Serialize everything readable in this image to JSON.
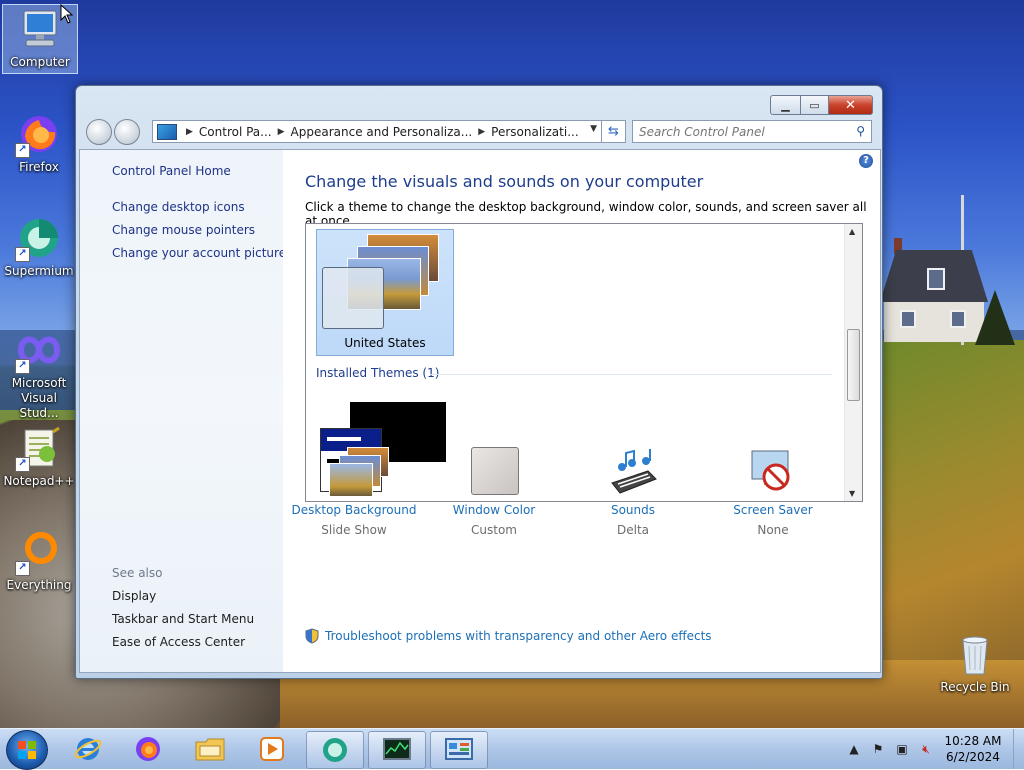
{
  "desktop": {
    "icons": [
      {
        "label": "Computer",
        "selected": true
      },
      {
        "label": "Firefox"
      },
      {
        "label": "Supermium"
      },
      {
        "label": "Microsoft Visual Stud..."
      },
      {
        "label": "Notepad++"
      },
      {
        "label": "Everything"
      },
      {
        "label": "Recycle Bin"
      }
    ]
  },
  "window": {
    "address": {
      "crumbs": [
        "Control Pa...",
        "Appearance and Personaliza...",
        "Personalizati..."
      ]
    },
    "search": {
      "placeholder": "Search Control Panel"
    },
    "left_pane": {
      "home": "Control Panel Home",
      "links": [
        "Change desktop icons",
        "Change mouse pointers",
        "Change your account picture"
      ],
      "see_also_header": "See also",
      "see_also": [
        "Display",
        "Taskbar and Start Menu",
        "Ease of Access Center"
      ]
    },
    "main": {
      "title": "Change the visuals and sounds on your computer",
      "subtitle": "Click a theme to change the desktop background, window color, sounds, and screen saver all at once.",
      "selected_theme": "United States",
      "installed_group": "Installed Themes (1)",
      "bottom_items": [
        {
          "label": "Desktop Background",
          "value": "Slide Show",
          "icon": "desktop-background-icon"
        },
        {
          "label": "Window Color",
          "value": "Custom",
          "icon": "window-color-icon"
        },
        {
          "label": "Sounds",
          "value": "Delta",
          "icon": "sounds-icon"
        },
        {
          "label": "Screen Saver",
          "value": "None",
          "icon": "screen-saver-icon"
        }
      ],
      "aero_link": "Troubleshoot problems with transparency and other Aero effects"
    }
  },
  "taskbar": {
    "clock_time": "10:28 AM",
    "clock_date": "6/2/2024",
    "pinned": [
      "internet-explorer-icon",
      "firefox-icon",
      "file-explorer-icon",
      "media-player-icon",
      "supermium-icon",
      "task-manager-icon",
      "control-panel-icon"
    ]
  },
  "colors": {
    "link": "#1c6fb7",
    "title": "#1e3d8f",
    "selection": "#cde3fb"
  }
}
